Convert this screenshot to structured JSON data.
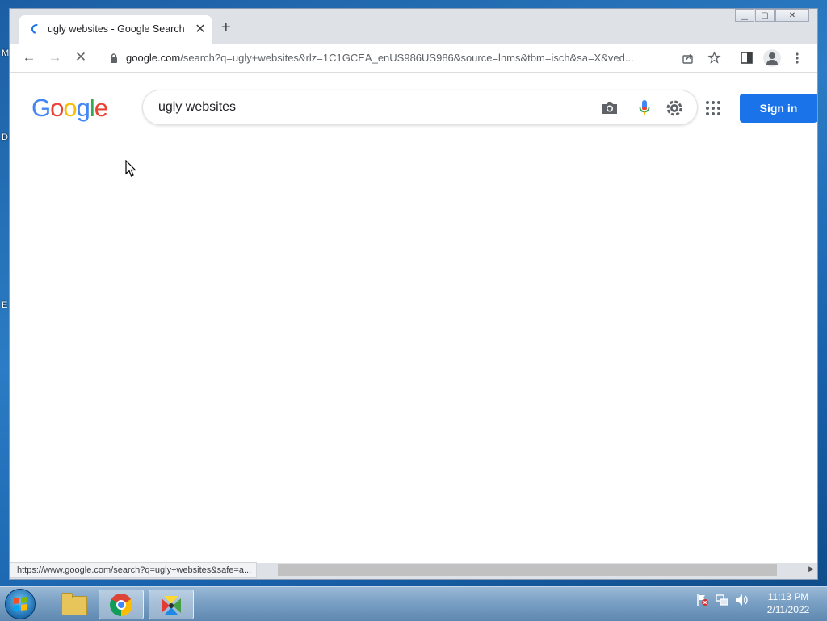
{
  "desktop": {
    "glyphs": [
      "M",
      "D",
      "E"
    ]
  },
  "browser": {
    "tab": {
      "title": "ugly websites - Google Search",
      "close": "✕"
    },
    "new_tab": "+",
    "window_controls": {
      "minimize": "▁",
      "maximize": "▢",
      "close": "✕"
    },
    "toolbar": {
      "back": "←",
      "forward": "→",
      "reload": "✕",
      "url_host": "google.com",
      "url_path": "/search?q=ugly+websites&rlz=1C1GCEA_enUS986US986&source=lnms&tbm=isch&sa=X&ved..."
    }
  },
  "page": {
    "logo": [
      "G",
      "o",
      "o",
      "g",
      "l",
      "e"
    ],
    "logo_colors": [
      "#4285f4",
      "#ea4335",
      "#fbbc05",
      "#4285f4",
      "#34a853",
      "#ea4335"
    ],
    "search": {
      "query": "ugly websites"
    },
    "signin_label": "Sign in",
    "status_url": "https://www.google.com/search?q=ugly+websites&safe=a..."
  },
  "taskbar": {
    "clock_time": "11:13 PM",
    "clock_date": "2/11/2022"
  }
}
